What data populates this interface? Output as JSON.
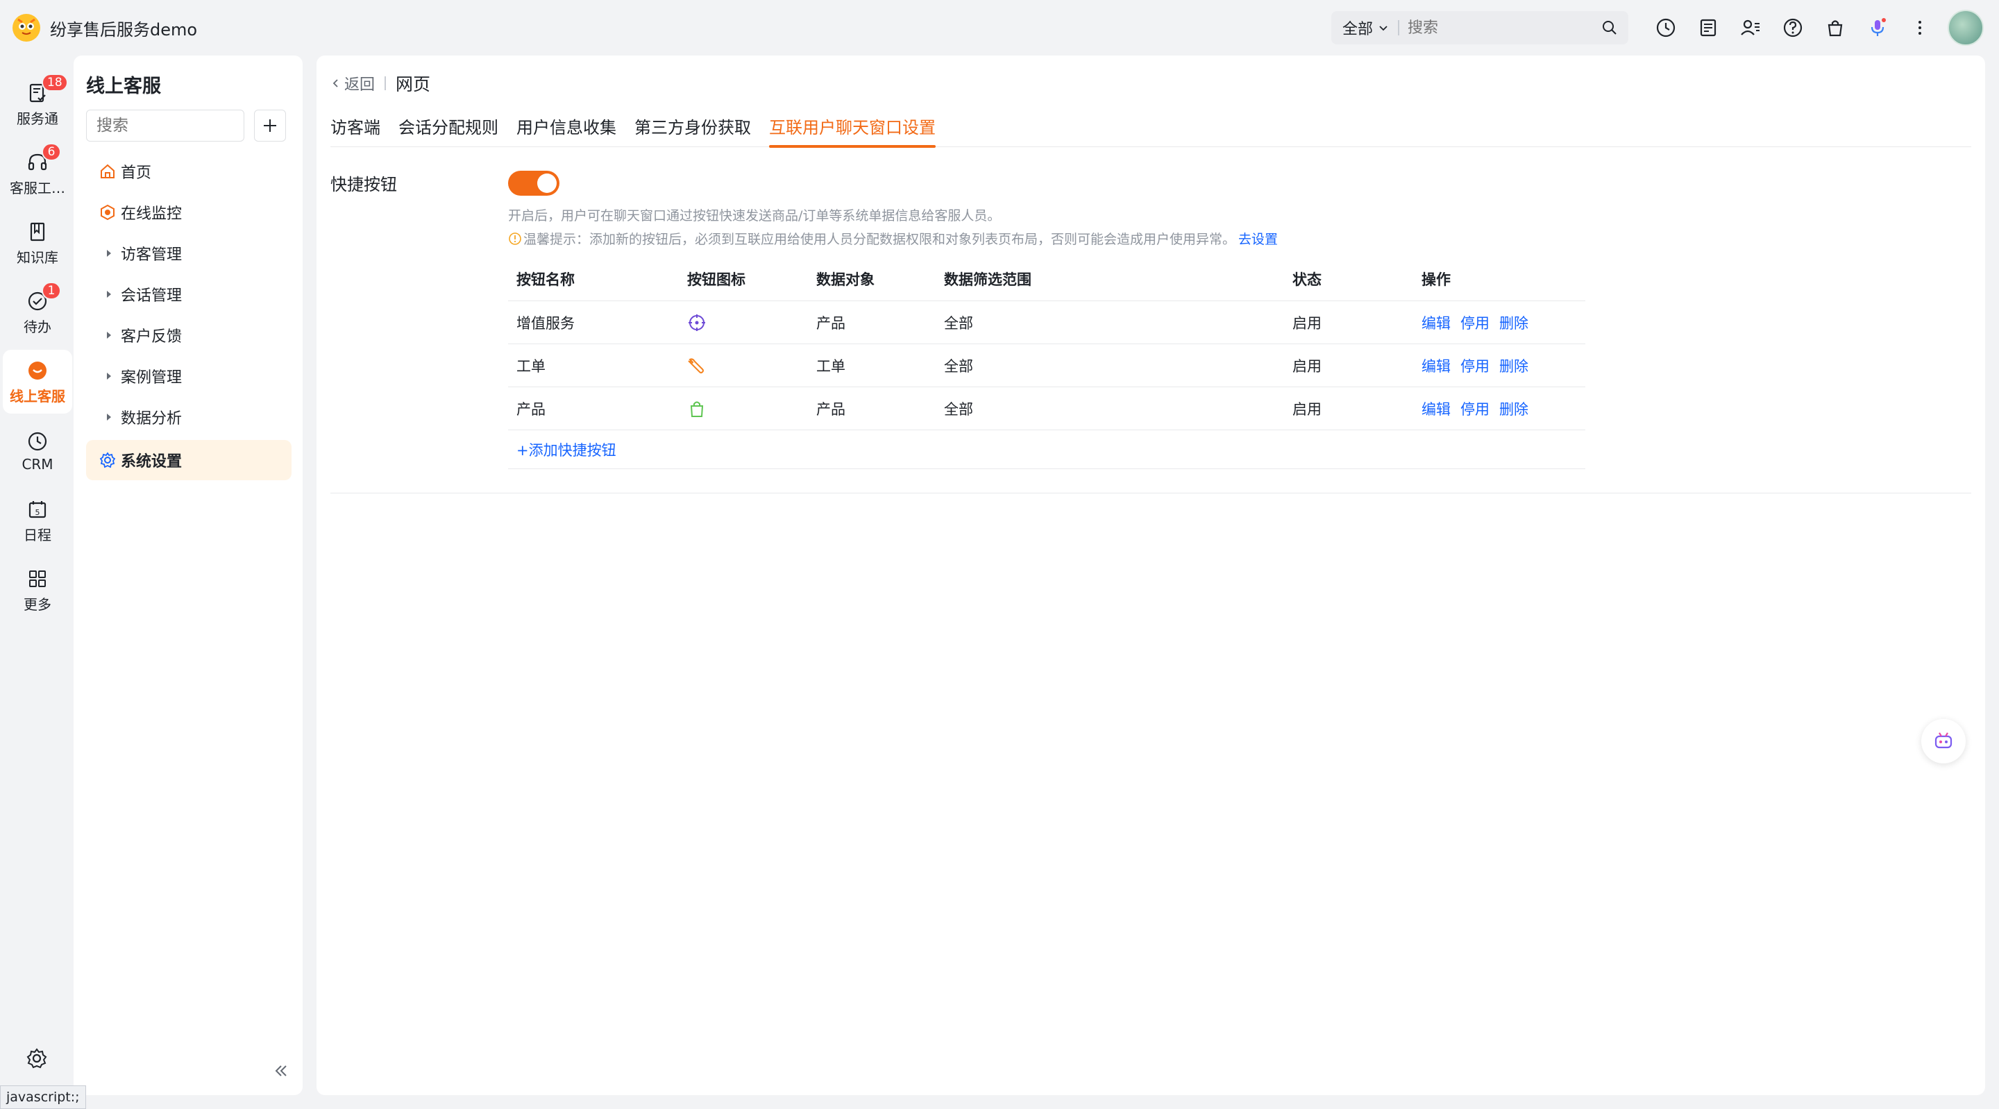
{
  "app": {
    "title": "纷享售后服务demo"
  },
  "topbar": {
    "scope": "全部",
    "search_placeholder": "搜索",
    "icons": [
      "clock-icon",
      "document-icon",
      "contacts-icon",
      "help-icon",
      "bag-icon",
      "microphone-icon",
      "more-icon"
    ]
  },
  "leftnav": [
    {
      "label": "服务通",
      "badge": "18",
      "icon": "service-icon"
    },
    {
      "label": "客服工…",
      "badge": "6",
      "icon": "headset-icon"
    },
    {
      "label": "知识库",
      "badge": "",
      "icon": "book-icon"
    },
    {
      "label": "待办",
      "badge": "1",
      "icon": "check-circle-icon"
    },
    {
      "label": "线上客服",
      "badge": "",
      "icon": "chat-icon",
      "active": true
    },
    {
      "label": "CRM",
      "badge": "",
      "icon": "crm-icon"
    },
    {
      "label": "日程",
      "badge": "",
      "icon": "calendar-icon"
    },
    {
      "label": "更多",
      "badge": "",
      "icon": "grid-icon"
    }
  ],
  "sidebar": {
    "title": "线上客服",
    "search_placeholder": "搜索",
    "items": [
      {
        "label": "首页"
      },
      {
        "label": "在线监控"
      },
      {
        "label": "访客管理"
      },
      {
        "label": "会话管理"
      },
      {
        "label": "客户反馈"
      },
      {
        "label": "案例管理"
      },
      {
        "label": "数据分析"
      },
      {
        "label": "系统设置"
      }
    ]
  },
  "main": {
    "back": "返回",
    "page": "网页",
    "tabs": [
      "访客端",
      "会话分配规则",
      "用户信息收集",
      "第三方身份获取",
      "互联用户聊天窗口设置"
    ],
    "active_tab": 4,
    "field_label": "快捷按钮",
    "toggle_on": true,
    "description": "开启后，用户可在聊天窗口通过按钮快速发送商品/订单等系统单据信息给客服人员。",
    "tip": "温馨提示：添加新的按钮后，必须到互联应用给使用人员分配数据权限和对象列表页布局，否则可能会造成用户使用异常。",
    "tip_link": "去设置",
    "table": {
      "headers": [
        "按钮名称",
        "按钮图标",
        "数据对象",
        "数据筛选范围",
        "状态",
        "操作"
      ],
      "rows": [
        {
          "name": "增值服务",
          "icon": "crosshair-icon",
          "object": "产品",
          "range": "全部",
          "status": "启用"
        },
        {
          "name": "工单",
          "icon": "wrench-icon",
          "object": "工单",
          "range": "全部",
          "status": "启用"
        },
        {
          "name": "产品",
          "icon": "bag-icon",
          "object": "产品",
          "range": "全部",
          "status": "启用"
        }
      ],
      "actions": [
        "编辑",
        "停用",
        "删除"
      ],
      "add_label": "+添加快捷按钮"
    }
  },
  "statusbar": "javascript:;",
  "colors": {
    "accent": "#f26a16",
    "link": "#1664ff",
    "badge": "#f54a45"
  }
}
